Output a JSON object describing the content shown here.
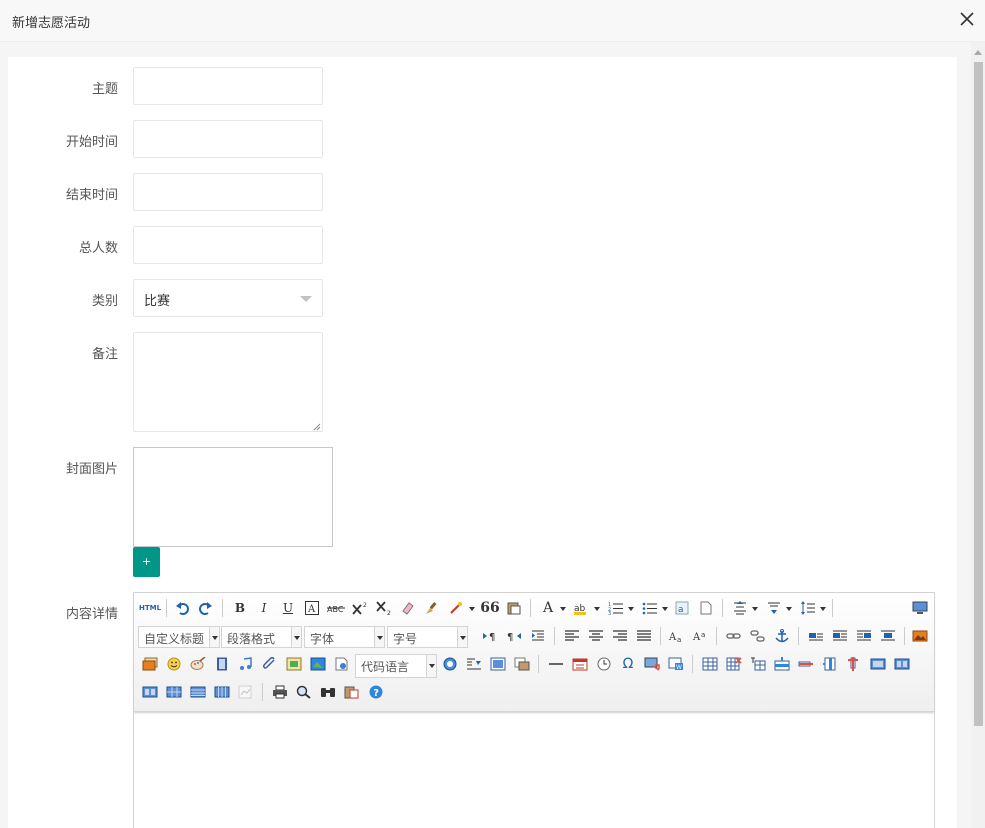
{
  "dialog": {
    "title": "新增志愿活动"
  },
  "form": {
    "subject_label": "主题",
    "start_label": "开始时间",
    "end_label": "结束时间",
    "total_label": "总人数",
    "category_label": "类别",
    "category_value": "比赛",
    "remark_label": "备注",
    "cover_label": "封面图片",
    "add_button": "+",
    "content_label": "内容详情"
  },
  "editor": {
    "html_label": "HTML",
    "bold": "B",
    "italic": "I",
    "underline": "U",
    "custom_heading": "自定义标题",
    "paragraph_format": "段落格式",
    "font_family": "字体",
    "font_size": "字号",
    "code_language": "代码语言",
    "blockquote": "66",
    "font_color": "A",
    "accent_color": "#009688"
  }
}
